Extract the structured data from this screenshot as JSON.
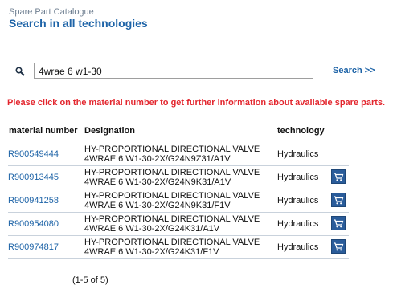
{
  "header": {
    "pre_title": "Spare Part Catalogue",
    "title": "Search in all technologies"
  },
  "search": {
    "icon": "search-icon",
    "value": "4wrae 6 w1-30",
    "button_label": "Search >>"
  },
  "notice": "Please click on the material number to get further information about available spare parts.",
  "table": {
    "columns": {
      "material": "material number",
      "designation": "Designation",
      "technology": "technology"
    },
    "rows": [
      {
        "material": "R900549444",
        "designation_line1": "HY-PROPORTIONAL DIRECTIONAL VALVE",
        "designation_line2": "4WRAE 6 W1-30-2X/G24N9Z31/A1V",
        "technology": "Hydraulics",
        "has_cart": false
      },
      {
        "material": "R900913445",
        "designation_line1": "HY-PROPORTIONAL DIRECTIONAL VALVE",
        "designation_line2": "4WRAE 6 W1-30-2X/G24N9K31/A1V",
        "technology": "Hydraulics",
        "has_cart": true
      },
      {
        "material": "R900941258",
        "designation_line1": "HY-PROPORTIONAL DIRECTIONAL VALVE",
        "designation_line2": "4WRAE 6 W1-30-2X/G24N9K31/F1V",
        "technology": "Hydraulics",
        "has_cart": true
      },
      {
        "material": "R900954080",
        "designation_line1": "HY-PROPORTIONAL DIRECTIONAL VALVE",
        "designation_line2": "4WRAE 6 W1-30-2X/G24K31/A1V",
        "technology": "Hydraulics",
        "has_cart": true
      },
      {
        "material": "R900974817",
        "designation_line1": "HY-PROPORTIONAL DIRECTIONAL VALVE",
        "designation_line2": "4WRAE 6 W1-30-2X/G24K31/F1V",
        "technology": "Hydraulics",
        "has_cart": true
      }
    ]
  },
  "pager": "(1-5 of 5)",
  "colors": {
    "title": "#1d63a7",
    "link": "#1d63a7",
    "notice": "#e3262e",
    "cart_button": "#2a5c9a",
    "row_divider": "#c9d2dc"
  }
}
